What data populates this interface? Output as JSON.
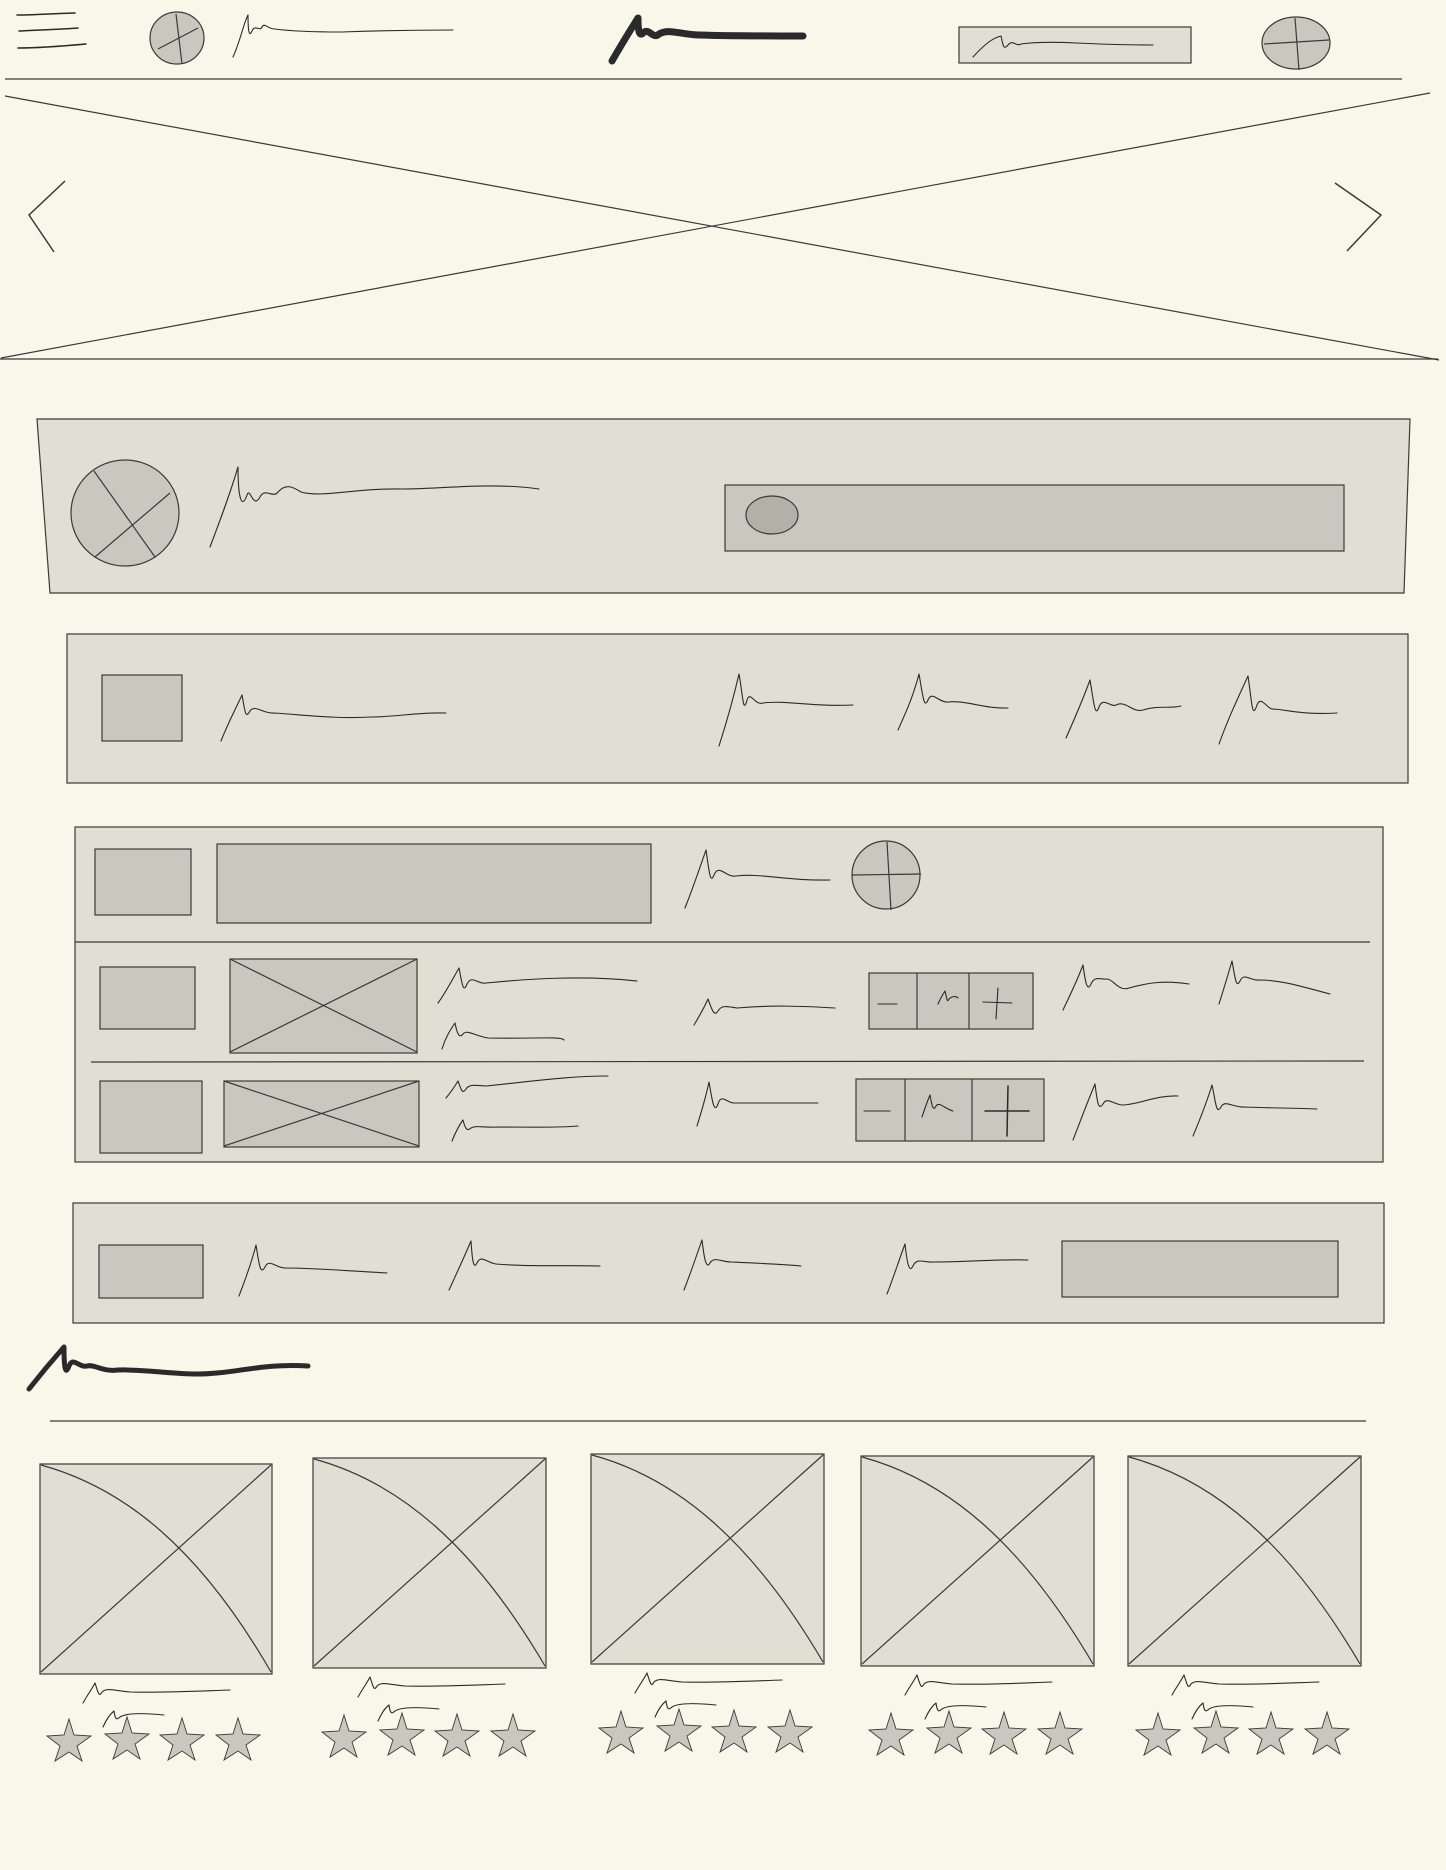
{
  "header": {
    "menu_icon": "hamburger-menu-icon",
    "avatar_icon": "avatar-placeholder-icon",
    "logo": "scribble-logo",
    "search": {},
    "cart_icon": "cart-placeholder-icon"
  },
  "hero": {
    "prev_icon": "chevron-left-icon",
    "next_icon": "chevron-right-icon"
  },
  "product_section": {
    "card_count": 5,
    "rating_stars": [
      4,
      4,
      4,
      4,
      4
    ]
  },
  "colors": {
    "page_bg": "#f9f7ea",
    "panel_bg": "#dfdfd3",
    "field_bg": "#c8c8bf",
    "ink": "#2a2a2a"
  }
}
